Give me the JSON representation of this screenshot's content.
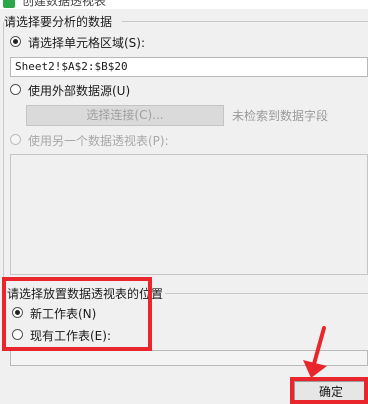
{
  "dialog": {
    "title": "创建数据透视表"
  },
  "source": {
    "section_label": "请选择要分析的数据",
    "option_range_label": "请选择单元格区域(S):",
    "range_value": "Sheet2!$A$2:$B$20",
    "option_external_label": "使用外部数据源(U)",
    "select_connection_label": "选择连接(C)...",
    "no_fields_hint": "未检索到数据字段",
    "option_other_pivot_label": "使用另一个数据透视表(P):"
  },
  "placement": {
    "section_label": "请选择放置数据透视表的位置",
    "option_new_sheet_label": "新工作表(N)",
    "option_existing_sheet_label": "现有工作表(E):"
  },
  "footer": {
    "ok_label": "确定"
  },
  "colors": {
    "annotation_red": "#e8262c",
    "app_green": "#2aa84a"
  }
}
